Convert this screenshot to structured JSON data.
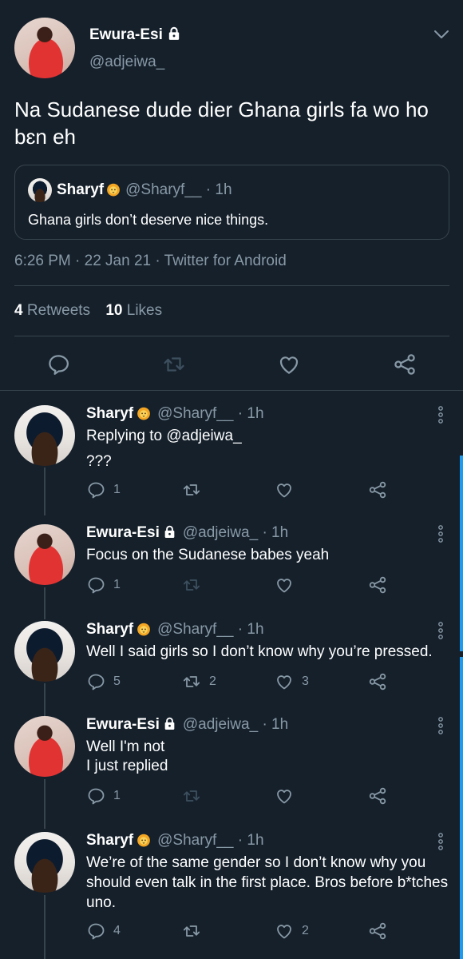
{
  "main_tweet": {
    "author_name": "Ewura-Esi",
    "author_handle": "@adjeiwa_",
    "text": "Na Sudanese dude dier Ghana girls fa wo ho bɛn eh",
    "quote": {
      "author_name": "Sharyf",
      "author_handle": "@Sharyf__",
      "time": "· 1h",
      "text": "Ghana girls don’t deserve nice things."
    },
    "meta": "6:26 PM · 22 Jan 21 · Twitter for Android",
    "retweets_count": "4",
    "retweets_label": "Retweets",
    "likes_count": "10",
    "likes_label": "Likes"
  },
  "replies": [
    {
      "author_name": "Sharyf",
      "author_handle": "@Sharyf__",
      "time": "· 1h",
      "replying_to_label": "Replying to",
      "replying_to_handle": "@adjeiwa_",
      "text": "???",
      "reply_count": "1",
      "retweet_count": "",
      "like_count": ""
    },
    {
      "author_name": "Ewura-Esi",
      "author_handle": "@adjeiwa_",
      "time": "· 1h",
      "text": "Focus on the Sudanese babes yeah",
      "reply_count": "1",
      "retweet_count": "",
      "like_count": ""
    },
    {
      "author_name": "Sharyf",
      "author_handle": "@Sharyf__",
      "time": "· 1h",
      "text": "Well I said girls so I don’t know why you’re pressed.",
      "reply_count": "5",
      "retweet_count": "2",
      "like_count": "3"
    },
    {
      "author_name": "Ewura-Esi",
      "author_handle": "@adjeiwa_",
      "time": "· 1h",
      "text_line1": "Well I'm not",
      "text_line2": "I just replied",
      "reply_count": "1",
      "retweet_count": "",
      "like_count": ""
    },
    {
      "author_name": "Sharyf",
      "author_handle": "@Sharyf__",
      "time": "· 1h",
      "text": "We’re of the same gender so I don’t know why you should even talk in the first place. Bros before b*tches uno.",
      "reply_count": "4",
      "retweet_count": "",
      "like_count": "2"
    }
  ],
  "colors": {
    "background": "#15202b",
    "muted": "#8899a6",
    "divider": "#38444d",
    "accent": "#1d9bf0",
    "emoji": "#f4a623"
  },
  "icons": [
    "lock-icon",
    "lion-emoji-icon",
    "chevron-down-icon",
    "reply-icon",
    "retweet-icon",
    "like-icon",
    "share-icon",
    "more-vertical-icon"
  ]
}
